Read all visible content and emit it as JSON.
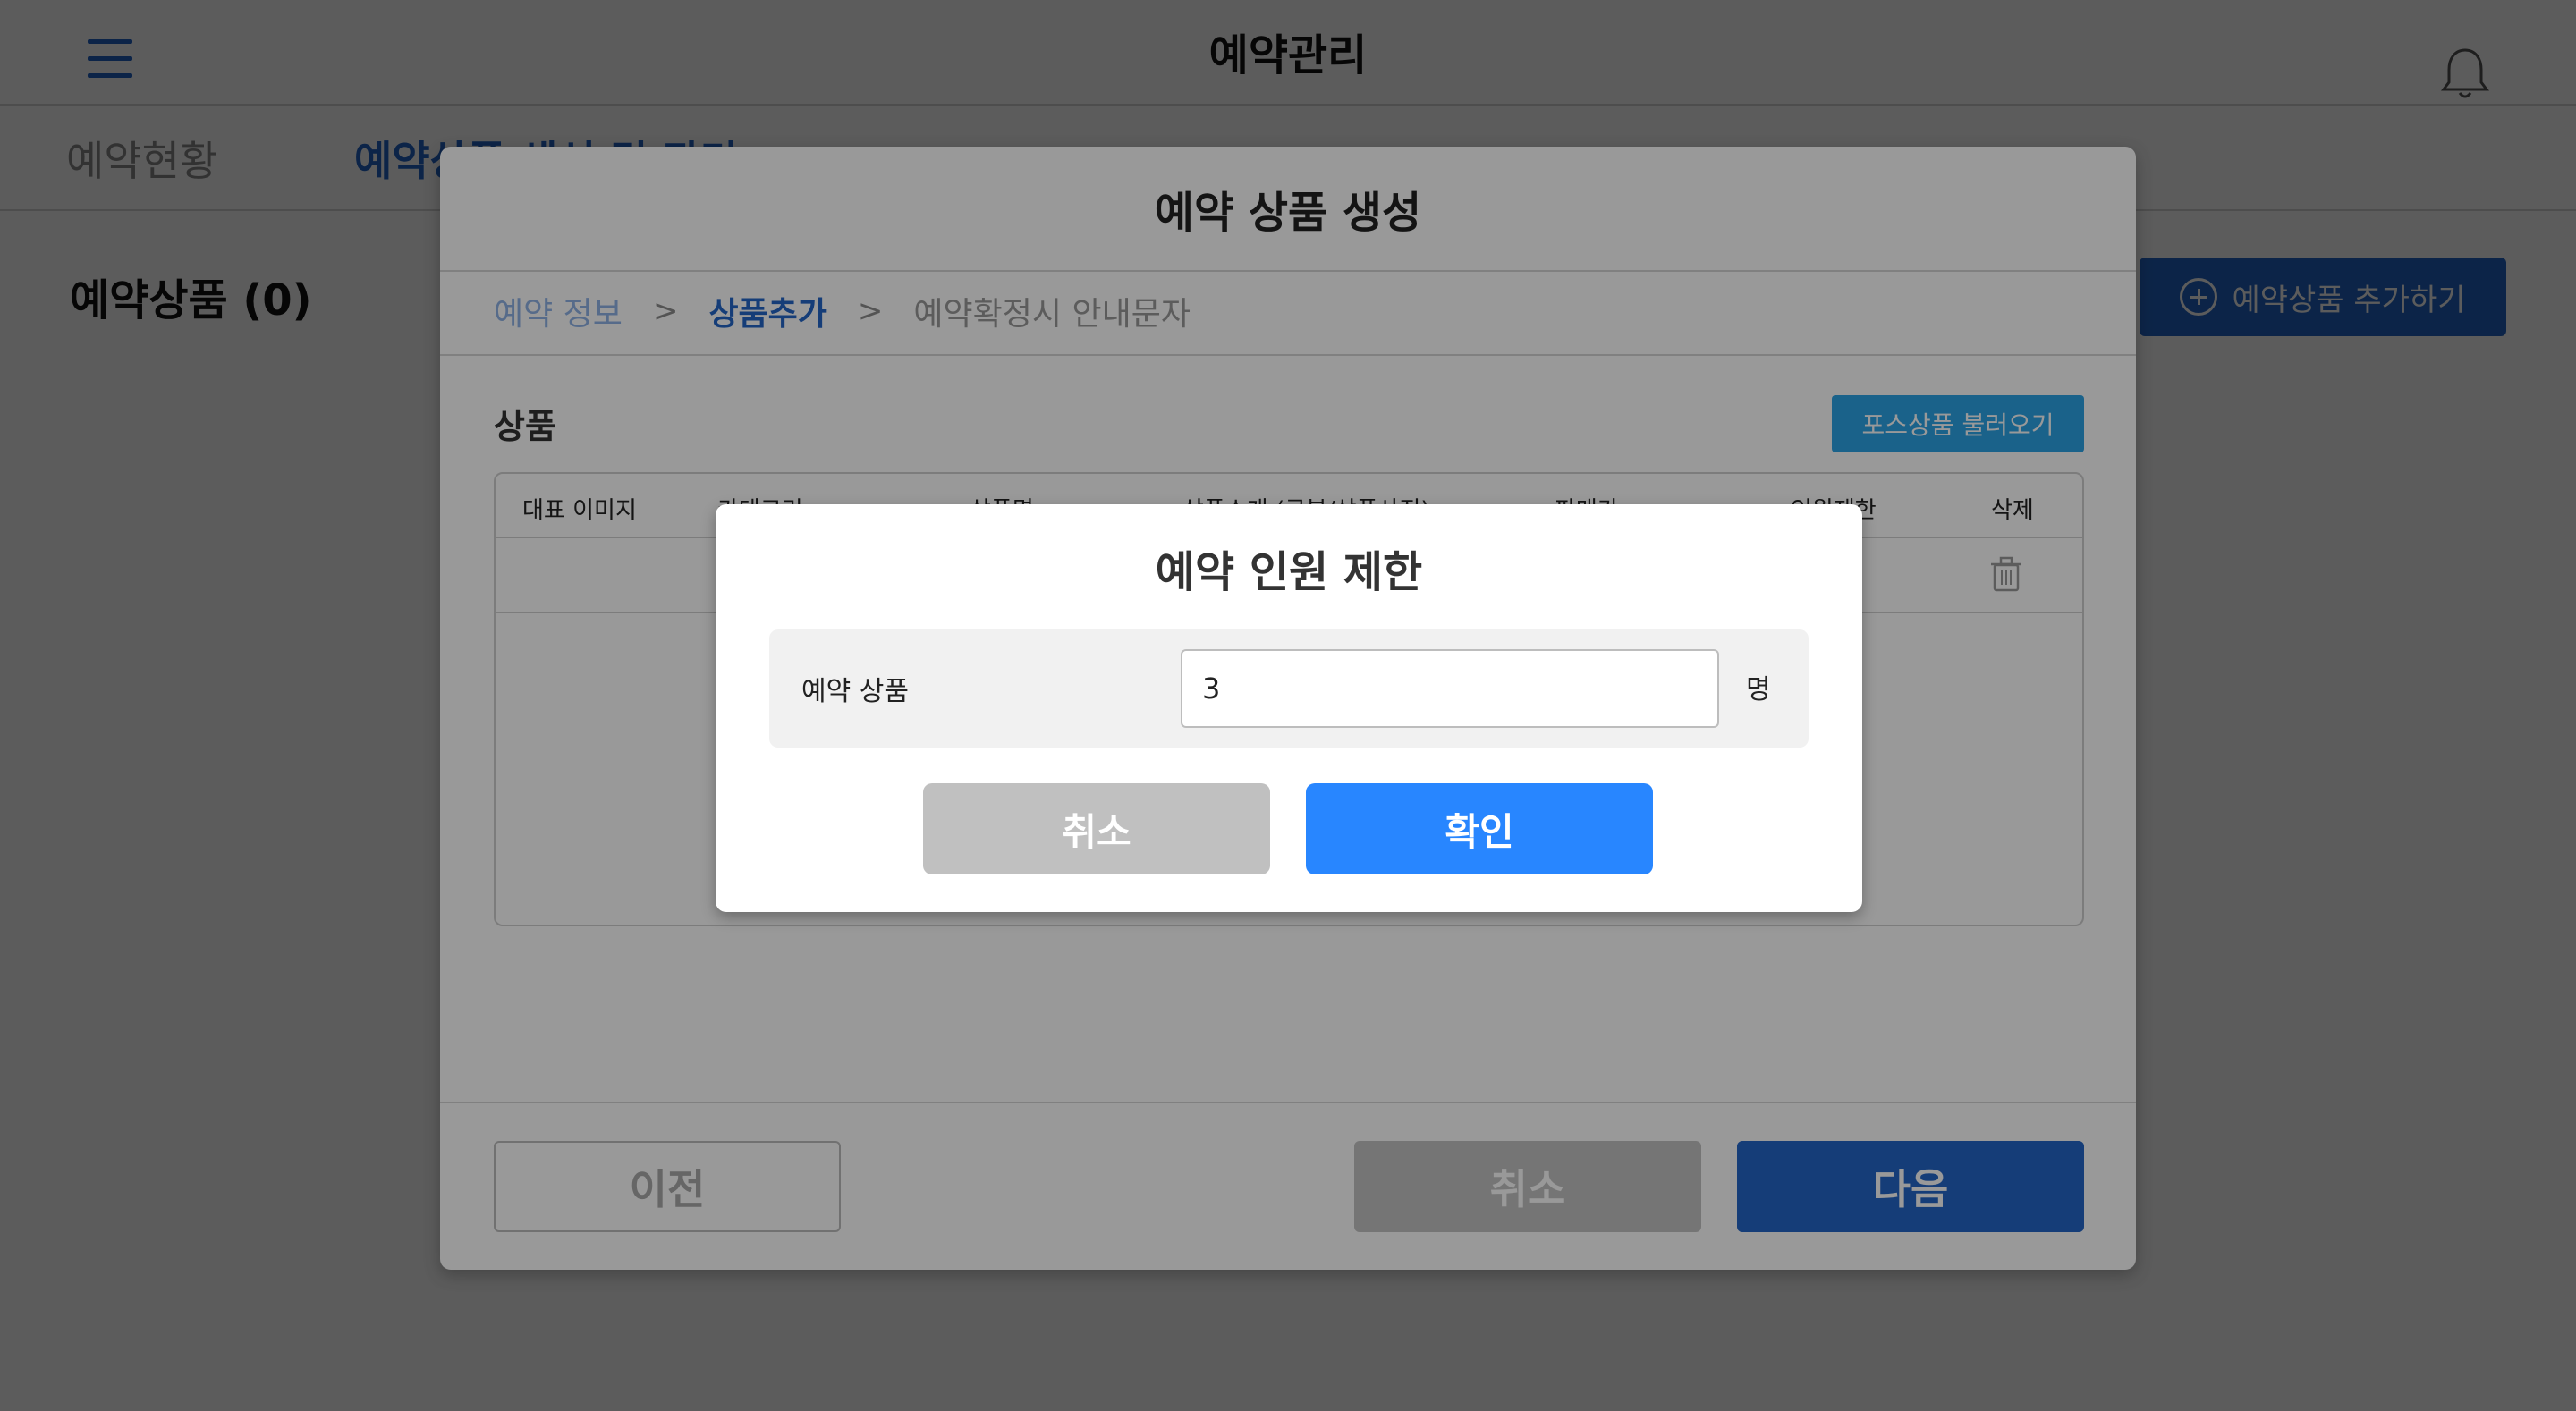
{
  "header": {
    "title": "예약관리"
  },
  "tabs": [
    {
      "label": "예약현황"
    },
    {
      "label": "예약상품 생성 및 관리"
    }
  ],
  "section": {
    "title": "예약상품 (0)",
    "add_button": "예약상품 추가하기"
  },
  "modal": {
    "title": "예약 상품 생성",
    "steps": [
      {
        "label": "예약 정보"
      },
      {
        "label": "상품추가"
      },
      {
        "label": "예약확정시 안내문자"
      }
    ],
    "product_label": "상품",
    "pos_button": "포스상품 불러오기",
    "table": {
      "headers": [
        "대표 이미지",
        "카테고리",
        "상품명",
        "상품소개 (구분/상품사진)",
        "판매가",
        "인원제한",
        "삭제"
      ]
    },
    "buttons": {
      "prev": "이전",
      "cancel": "취소",
      "next": "다음"
    }
  },
  "dialog": {
    "title": "예약 인원 제한",
    "field_label": "예약 상품",
    "field_value": "3",
    "unit": "명",
    "cancel": "취소",
    "confirm": "확인"
  },
  "colors": {
    "primary": "#2467c9",
    "confirm": "#2886ff",
    "pos": "#2ca3e6",
    "muted": "#c0c0c0"
  }
}
